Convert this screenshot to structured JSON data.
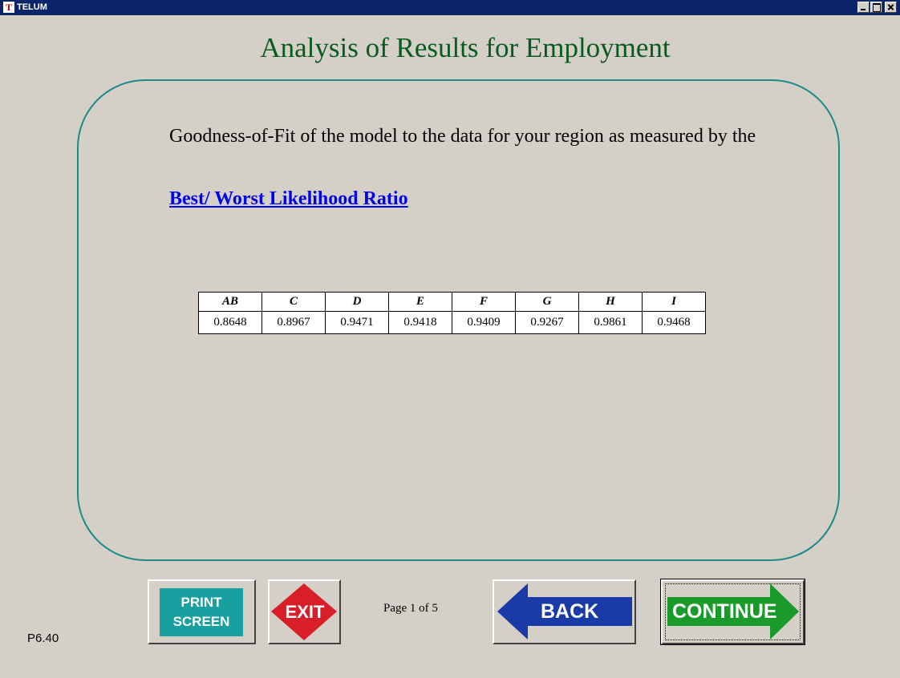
{
  "window": {
    "title": "TELUM",
    "icon": "T"
  },
  "page": {
    "title": "Analysis of Results for Employment",
    "intro": "Goodness-of-Fit of the model to the data for your region as measured by the",
    "link": "Best/ Worst Likelihood Ratio"
  },
  "table": {
    "headers": [
      "AB",
      "C",
      "D",
      "E",
      "F",
      "G",
      "H",
      "I"
    ],
    "values": [
      "0.8648",
      "0.8967",
      "0.9471",
      "0.9418",
      "0.9409",
      "0.9267",
      "0.9861",
      "0.9468"
    ]
  },
  "buttons": {
    "print_line1": "PRINT",
    "print_line2": "SCREEN",
    "exit": "EXIT",
    "back": "BACK",
    "continue": "CONTINUE"
  },
  "footer": {
    "page_indicator": "Page 1 of 5",
    "screen_code": "P6.40"
  },
  "colors": {
    "titlebar": "#0a246a",
    "title_text": "#0a5a1e",
    "panel_border": "#1a8a8a",
    "link": "#0000ee",
    "print_button": "#18a0a0",
    "exit_button": "#d81e28",
    "back_button": "#1a3aa8",
    "continue_button": "#1a9a2a"
  }
}
